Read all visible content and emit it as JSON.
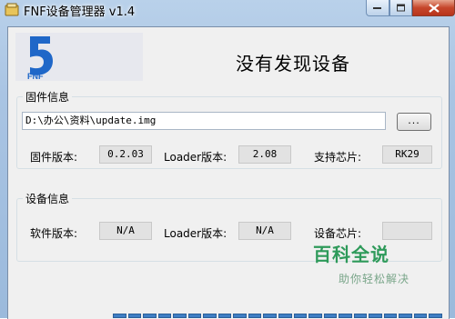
{
  "window": {
    "title": "FNF设备管理器 v1.4",
    "icon": "app-icon",
    "controls": {
      "minimize": "minimize-icon",
      "maximize": "maximize-icon",
      "close": "close-icon"
    }
  },
  "header": {
    "status_text": "没有发现设备"
  },
  "logo": {
    "digit": "5",
    "brand": "FNF"
  },
  "firmware_group": {
    "title": "固件信息",
    "path_value": "D:\\办公\\资料\\update.img",
    "browse_label": "...",
    "fw_version_label": "固件版本:",
    "fw_version_value": "0.2.03",
    "loader_version_label": "Loader版本:",
    "loader_version_value": "2.08",
    "supported_chip_label": "支持芯片:",
    "supported_chip_value": "RK29"
  },
  "device_group": {
    "title": "设备信息",
    "sw_version_label": "软件版本:",
    "sw_version_value": "N/A",
    "loader_version_label": "Loader版本:",
    "loader_version_value": "N/A",
    "device_chip_label": "设备芯片:",
    "device_chip_value": ""
  },
  "watermark": {
    "title": "百科全说",
    "subtitle": "助你轻松解决"
  },
  "progress": {
    "fraction": 1.0
  },
  "colors": {
    "accent": "#2e9a5a",
    "progress": "#3f7ec4",
    "logo": "#1f67c8"
  }
}
